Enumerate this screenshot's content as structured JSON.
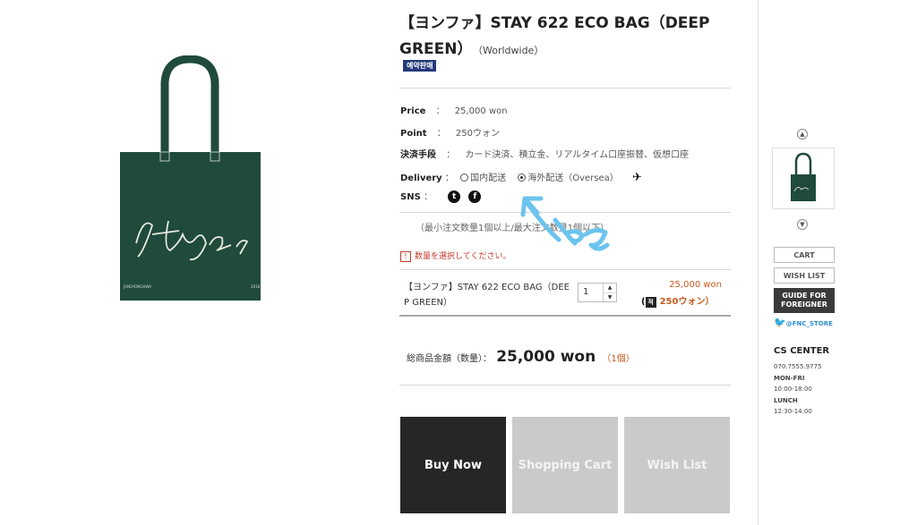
{
  "product": {
    "title": "【ヨンファ】STAY 622 ECO BAG（DEEP GREEN）",
    "region": "（Worldwide）",
    "badge": "예약판매",
    "image_caption": "Stay 622",
    "image_subtext": "JUNGYONGHWA",
    "image_year": "2018"
  },
  "info": {
    "price_label": "Price",
    "price_value": "25,000 won",
    "point_label": "Point",
    "point_value": "250ウォン",
    "payment_label": "決済手段",
    "payment_value": "カード決済、積立金、リアルタイム口座振替、仮想口座",
    "delivery_label": "Delivery",
    "delivery_opt1": "国内配送",
    "delivery_opt2": "海外配送（Oversea）",
    "sns_label": "SNS",
    "separator": "："
  },
  "order": {
    "note": "（最小注文数量1個以上/最大注文数量1個以下）",
    "warning": "数量を選択してください。",
    "item_name": "【ヨンファ】STAY 622 ECO BAG（DEEP GREEN）",
    "item_name_line1": "【ヨンファ】STAY 622 ECO BAG（DEE",
    "item_name_line2": "P GREEN）",
    "qty": "1",
    "item_price": "25,000 won",
    "item_point": "250ウォン）",
    "total_label": "総商品金額（数量）：",
    "total_value": "25,000 won",
    "total_count": "（1個）"
  },
  "buttons": {
    "buy_now": "Buy Now",
    "shopping_cart": "Shopping Cart",
    "wish_list": "Wish List"
  },
  "sidebar": {
    "cart": "CART",
    "wish_list": "WISH LIST",
    "guide_line1": "GUIDE FOR",
    "guide_line2": "FOREIGNER",
    "twitter": "@FNC_STORE",
    "cs_title": "CS CENTER",
    "cs_phone": "070.7555.9775",
    "cs_days": "MON-FRI",
    "cs_hours": "10:00-18:00",
    "cs_lunch_label": "LUNCH",
    "cs_lunch": "12:30-14:00"
  },
  "colors": {
    "bag_green": "#1f4a3c",
    "accent_orange": "#c65a1e",
    "dark_button": "#262626",
    "gray_button": "#cacaca",
    "annotation_blue": "#6cc4ee"
  }
}
